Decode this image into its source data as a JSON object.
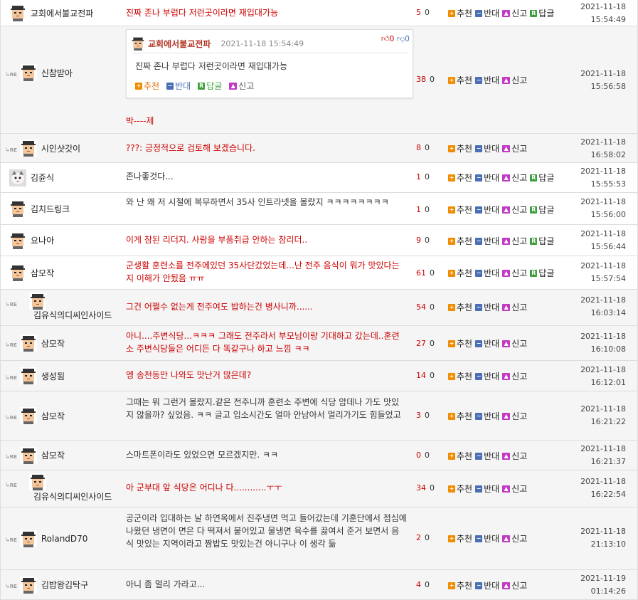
{
  "icons": {
    "re_label": "RE",
    "vote_up_icon": "thumbs-up-icon",
    "vote_down_icon": "thumbs-down-icon"
  },
  "actions": {
    "recommend": "추천",
    "oppose": "반대",
    "report": "신고",
    "reply": "답글"
  },
  "quote": {
    "user": "교회에서불교전파",
    "date": "2021-11-18 15:54:49",
    "up": "0",
    "down": "0",
    "text": "진짜 존나 부럽다 저런곳이라면 재입대가능"
  },
  "comments": [
    {
      "user": "교회에서불교전파",
      "text": "진짜 존나 부럽다 저런곳이라면 재입대가능",
      "up": "5",
      "down": "0",
      "date": "2021-11-18",
      "time": "15:54:49"
    },
    {
      "user": "신참받아",
      "text": "박----제",
      "up": "38",
      "down": "0",
      "date": "2021-11-18",
      "time": "15:56:58"
    },
    {
      "user": "시인샷갓이",
      "text": "???: 긍정적으로 검토해 보겠습니다.",
      "up": "8",
      "down": "0",
      "date": "2021-11-18",
      "time": "16:58:02"
    },
    {
      "user": "김쥰식",
      "text": "존나좋것다...",
      "up": "1",
      "down": "0",
      "date": "2021-11-18",
      "time": "15:55:53"
    },
    {
      "user": "김치드링크",
      "text": "와 난 왜 저 시절에 복무하면서 35사 인트라넷을 몰랐지 ㅋㅋㅋㅋㅋㅋㅋㅋ",
      "up": "1",
      "down": "0",
      "date": "2021-11-18",
      "time": "15:56:00"
    },
    {
      "user": "요나아",
      "text": "이게 참된 리더지. 사람을 부품취급 안하는 참리더..",
      "up": "9",
      "down": "0",
      "date": "2021-11-18",
      "time": "15:56:44"
    },
    {
      "user": "삼모작",
      "text": "군생활 훈련소를 전주에있던 35사단갔었는데...난 전주 음식이 뭐가 맛있다는지 이해가 안됬음 ㅠㅠ",
      "up": "61",
      "down": "0",
      "date": "2021-11-18",
      "time": "15:57:54"
    },
    {
      "user": "김유식의디씨인사이드",
      "text": "그건 어쩔수 없는게 전주여도 밥하는건 병사니까......",
      "up": "54",
      "down": "0",
      "date": "2021-11-18",
      "time": "16:03:14"
    },
    {
      "user": "삼모작",
      "text": "아니....주변식당...ㅋㅋㅋ 그래도 전주라서 부모님이랑 기대하고 갔는데..훈련소 주변식당들은 어디든 다 똑같구나 하고 느낌 ㅋㅋ",
      "up": "27",
      "down": "0",
      "date": "2021-11-18",
      "time": "16:10:08"
    },
    {
      "user": "생성됨",
      "text": "엥 송천동만 나와도 맛난거 많은데?",
      "up": "14",
      "down": "0",
      "date": "2021-11-18",
      "time": "16:12:01"
    },
    {
      "user": "삼모작",
      "text": "그때는 뭐 그런거 몰랐지.같은 전주니까 훈련소 주변에 식당 암데나 가도 맛있지 않을까? 싶었음. ㅋㅋ 글고 입소시간도 얼마 안남아서 멀리가기도 힘들었고",
      "up": "3",
      "down": "0",
      "date": "2021-11-18",
      "time": "16:21:22"
    },
    {
      "user": "삼모작",
      "text": "스마트폰이라도 있었으면 모르겠지만. ㅋㅋ",
      "up": "0",
      "down": "0",
      "date": "2021-11-18",
      "time": "16:21:37"
    },
    {
      "user": "김유식의디씨인사이드",
      "text": "아 군부대 앞 식당은 어디나 다............ㅜㅜ",
      "up": "34",
      "down": "0",
      "date": "2021-11-18",
      "time": "16:22:54"
    },
    {
      "user": "RolandD70",
      "text": "공군이라 입대하는 날 하연옥에서 진주냉면 먹고 들어갔는데 기훈단에서 점심에 나왔던 냉면이 면은 다 떡져서 붙어있고 물냉면 육수를 끓여서 준거 보면서 음식 맛있는 지역이라고 짬밥도 맛있는건 아니구나 이 생각 듦",
      "up": "2",
      "down": "0",
      "date": "2021-11-18",
      "time": "21:13:10"
    },
    {
      "user": "김밥왕김탁구",
      "text": "아니 좀 멀리 가라고...",
      "up": "4",
      "down": "0",
      "date": "2021-11-19",
      "time": "01:14:26"
    }
  ]
}
